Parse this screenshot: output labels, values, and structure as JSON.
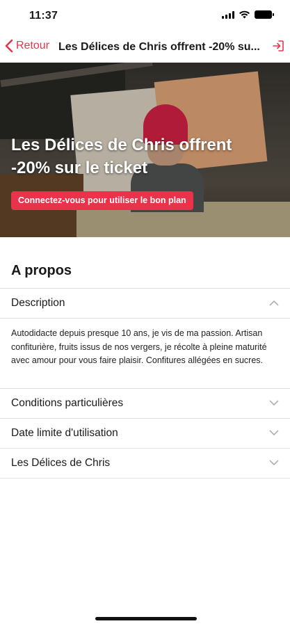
{
  "status_bar": {
    "time": "11:37",
    "icons": [
      "signal-icon",
      "wifi-icon",
      "battery-icon"
    ]
  },
  "nav": {
    "back_label": "Retour",
    "title": "Les Délices de Chris offrent -20% su...",
    "share_icon": "share-exit-icon"
  },
  "hero": {
    "title": "Les Délices de Chris offrent -20% sur le ticket",
    "cta_label": "Connectez-vous pour utiliser le bon plan"
  },
  "about": {
    "section_title": "A propos",
    "items": [
      {
        "label": "Description",
        "expanded": true,
        "body": "Autodidacte depuis presque 10 ans, je vis de ma passion. Artisan confiturière, fruits issus de nos vergers, je récolte à pleine maturité avec amour pour vous faire plaisir. Confitures allégées en sucres."
      },
      {
        "label": "Conditions particulières",
        "expanded": false
      },
      {
        "label": "Date limite d'utilisation",
        "expanded": false
      },
      {
        "label": "Les Délices de Chris",
        "expanded": false
      }
    ]
  },
  "colors": {
    "accent": "#e8334a",
    "text": "#1a1a1a",
    "divider": "#e3e3e3",
    "chevron": "#b0b0b0"
  }
}
